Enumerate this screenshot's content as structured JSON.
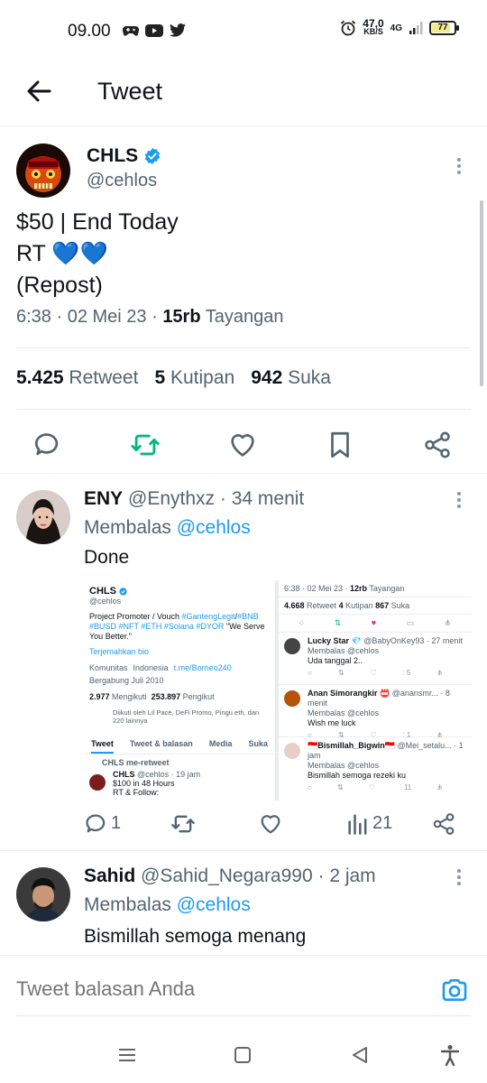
{
  "status_bar": {
    "time": "09.00",
    "speed_value": "47,0",
    "speed_unit": "KB/S",
    "network": "4G",
    "battery": "77"
  },
  "header": {
    "title": "Tweet"
  },
  "main_tweet": {
    "name": "CHLS",
    "handle": "@cehlos",
    "line1": "$50 | End Today",
    "line2": "RT 💙💙",
    "line3": "(Repost)",
    "time": "6:38 · 02 Mei 23 · ",
    "views_count": "15rb",
    "views_label": " Tayangan",
    "retweets_count": "5.425",
    "retweets_label": "Retweet",
    "quotes_count": "5",
    "quotes_label": "Kutipan",
    "likes_count": "942",
    "likes_label": "Suka"
  },
  "replies": [
    {
      "name": "ENY",
      "handle": "@Enythxz",
      "time": " · 34 menit",
      "replying_prefix": "Membalas ",
      "replying_to": "@cehlos",
      "text": "Done",
      "reply_count": "1",
      "views_count": "21"
    },
    {
      "name": "Sahid",
      "handle": "@Sahid_Negara990",
      "time": " · 2 jam",
      "replying_prefix": "Membalas ",
      "replying_to": "@cehlos",
      "text": "Bismillah semoga menang"
    }
  ],
  "media": {
    "left": {
      "name": "CHLS",
      "handle": "@cehlos",
      "bio_1": "Project Promoter / Vouch ",
      "bio_tag1": "#GantengLegit",
      "bio_sep": "/",
      "bio_tag2": "#BNB",
      "bio_tags": "#BUSD #NFT #ETH #Solana #DYOR",
      "bio_end": " \"We Serve You Better.\"",
      "translate": "Terjemahkan bio",
      "community": "Komunitas",
      "location": "Indonesia",
      "link": "t.me/Borneo240",
      "joined": "Bergabung Juli 2010",
      "following_count": "2.977",
      "following_label": " Mengikuti",
      "followers_count": "253.897",
      "followers_label": " Pengikut",
      "followed_by": "Diikuti oleh Lil Pace, DeFi Promo, Pingu.eth, dan 220 lainnya",
      "tab1": "Tweet",
      "tab2": "Tweet & balasan",
      "tab3": "Media",
      "tab4": "Suka",
      "retweet_note": "CHLS me-retweet",
      "inner_name": "CHLS",
      "inner_handle": "@cehlos · 19 jam",
      "inner_text1": "$100 in 48 Hours",
      "inner_text2": "RT & Follow:"
    },
    "right": {
      "meta": "6:38 · 02 Mei 23 · ",
      "meta_views": "12rb",
      "meta_views_label": " Tayangan",
      "stats_rt": "4.668",
      "stats_rt_label": " Retweet ",
      "stats_q": "4",
      "stats_q_label": " Kutipan ",
      "stats_l": "867",
      "stats_l_label": " Suka",
      "r1_name": "Lucky Star 💎",
      "r1_handle": " @BabyOnKey93 · 27 menit",
      "r1_sub": "Membalas @cehlos",
      "r1_text": "Uda tanggal 2..",
      "r1_views": "5",
      "r2_name": "Anan Simorangkir 📛",
      "r2_handle": " @anansmr... · 8 menit",
      "r2_sub": "Membalas @cehlos",
      "r2_text": "Wish me luck",
      "r2_views": "1",
      "r3_name": "🇮🇩Bismillah_Bigwin🇮🇩",
      "r3_handle": " @Mei_setalu... · 1 jam",
      "r3_sub": "Membalas @cehlos",
      "r3_text": "Bismillah semoga rezeki ku",
      "r3_views": "11"
    }
  },
  "reply_box": {
    "placeholder": "Tweet balasan Anda"
  },
  "colors": {
    "accent": "#1d9bf0",
    "retweet": "#00ba7c",
    "text": "#0f1419",
    "muted": "#536471"
  }
}
